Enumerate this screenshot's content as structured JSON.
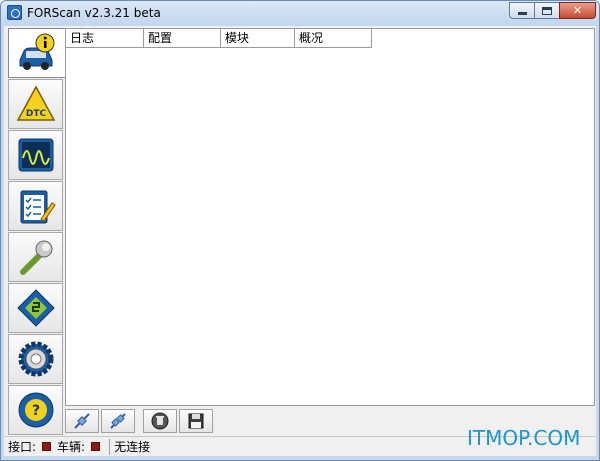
{
  "window": {
    "title": "FORScan v2.3.21 beta"
  },
  "sidebar": {
    "items": [
      {
        "name": "vehicle-info",
        "icon": "car-info-icon"
      },
      {
        "name": "dtc",
        "icon": "dtc-warning-icon"
      },
      {
        "name": "oscilloscope",
        "icon": "oscilloscope-icon"
      },
      {
        "name": "tests",
        "icon": "checklist-icon"
      },
      {
        "name": "service",
        "icon": "wrench-icon"
      },
      {
        "name": "configuration",
        "icon": "chip-icon"
      },
      {
        "name": "settings",
        "icon": "gear-icon"
      },
      {
        "name": "help",
        "icon": "help-icon"
      }
    ]
  },
  "tabs": [
    {
      "label": "日志"
    },
    {
      "label": "配置"
    },
    {
      "label": "模块"
    },
    {
      "label": "概况"
    }
  ],
  "toolbar": {
    "buttons": [
      {
        "name": "connect",
        "icon": "connect-icon"
      },
      {
        "name": "disconnect",
        "icon": "disconnect-icon"
      },
      {
        "name": "clear",
        "icon": "delete-icon"
      },
      {
        "name": "save",
        "icon": "save-icon"
      }
    ]
  },
  "status": {
    "port_label": "接口:",
    "vehicle_label": "车辆:",
    "connection_text": "无连接",
    "indicator_color": "#8b1a10"
  },
  "watermark": "ITMOP.COM"
}
